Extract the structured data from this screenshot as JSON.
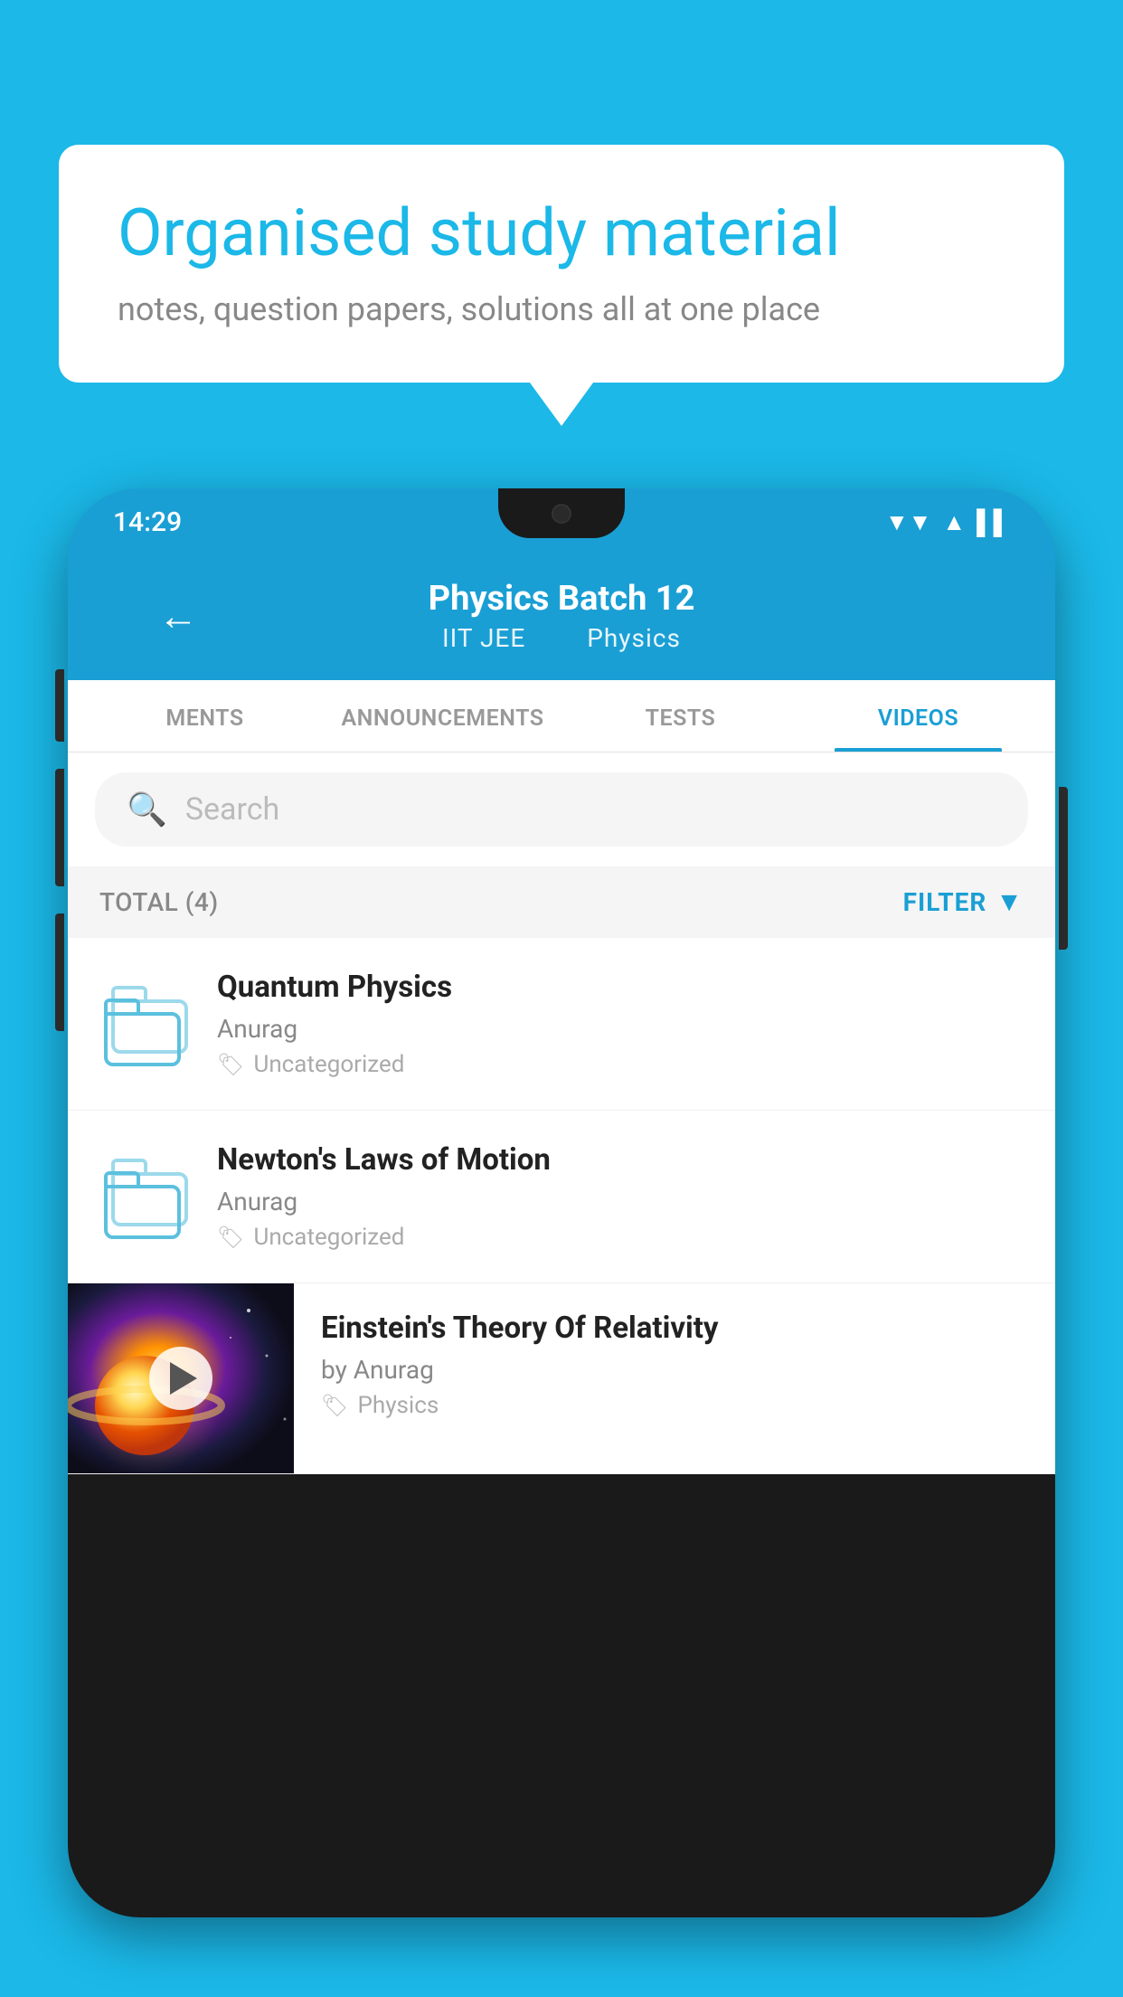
{
  "background_color": "#1bb8e8",
  "speech_bubble": {
    "title": "Organised study material",
    "subtitle": "notes, question papers, solutions all at one place"
  },
  "status_bar": {
    "time": "14:29",
    "icons": [
      "▼▼",
      "▲",
      "▌▌"
    ]
  },
  "header": {
    "back_label": "←",
    "title": "Physics Batch 12",
    "subtitle_part1": "IIT JEE",
    "subtitle_part2": "Physics"
  },
  "tabs": [
    {
      "label": "MENTS",
      "active": false
    },
    {
      "label": "ANNOUNCEMENTS",
      "active": false
    },
    {
      "label": "TESTS",
      "active": false
    },
    {
      "label": "VIDEOS",
      "active": true
    }
  ],
  "search": {
    "placeholder": "Search"
  },
  "filter_row": {
    "total_label": "TOTAL (4)",
    "filter_label": "FILTER"
  },
  "videos": [
    {
      "title": "Quantum Physics",
      "author": "Anurag",
      "tag": "Uncategorized",
      "has_thumbnail": false
    },
    {
      "title": "Newton's Laws of Motion",
      "author": "Anurag",
      "tag": "Uncategorized",
      "has_thumbnail": false
    },
    {
      "title": "Einstein's Theory Of Relativity",
      "author": "by Anurag",
      "tag": "Physics",
      "has_thumbnail": true
    }
  ]
}
